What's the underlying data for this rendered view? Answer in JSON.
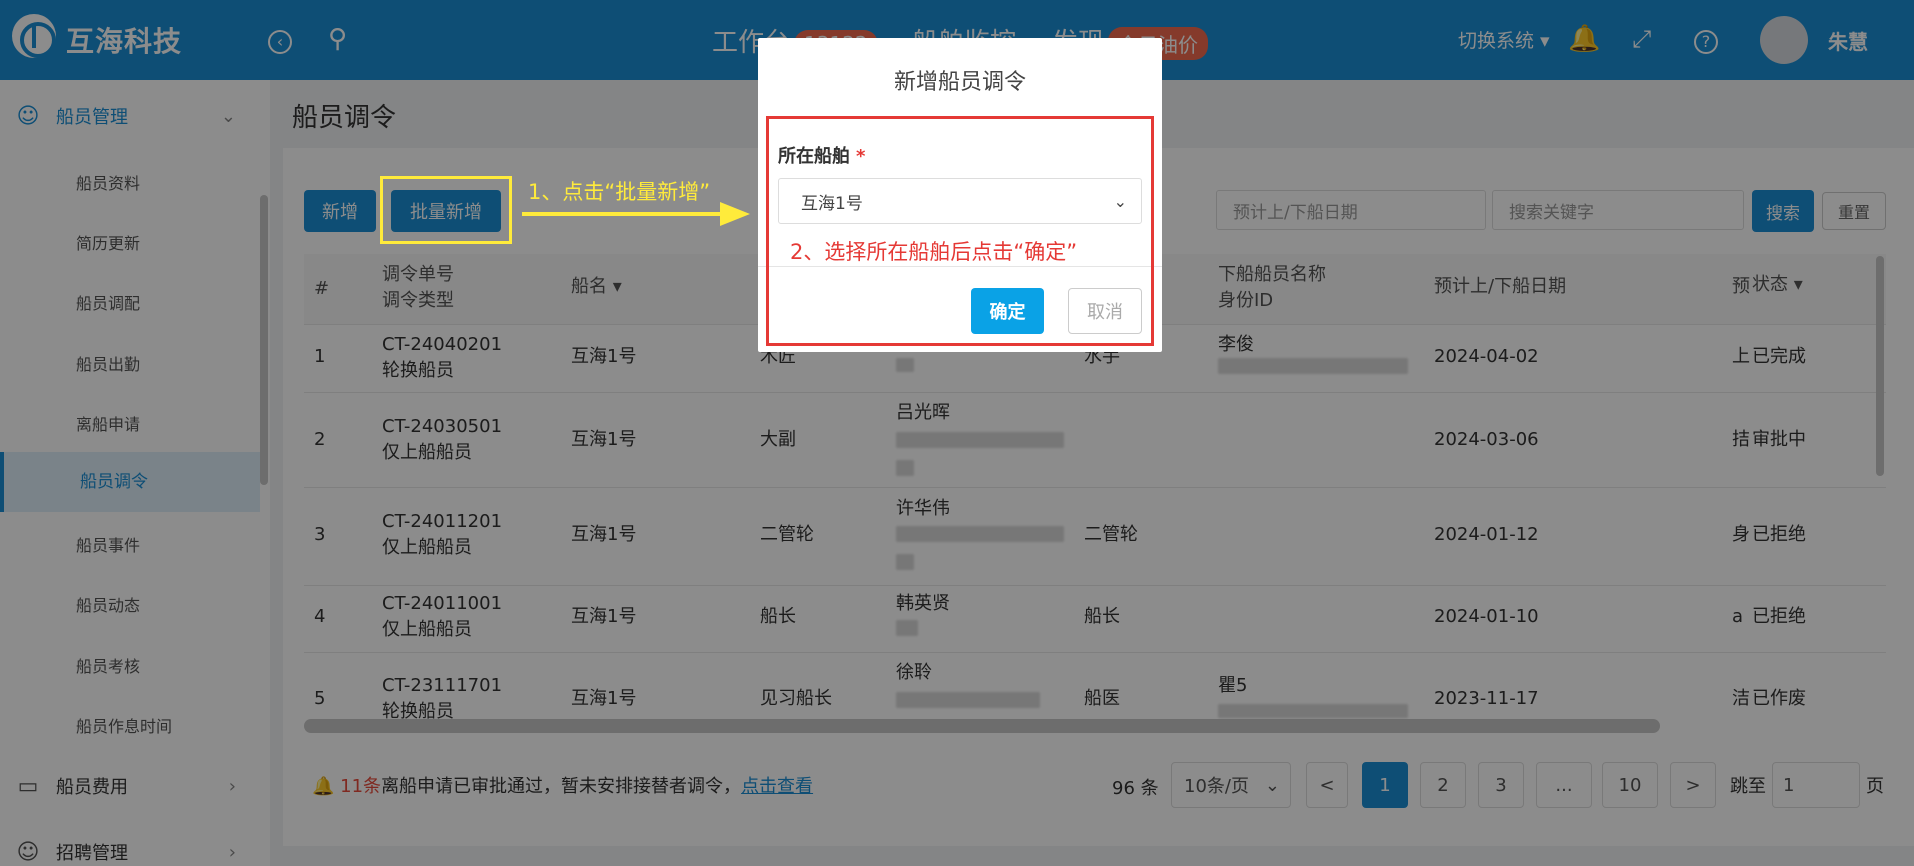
{
  "header": {
    "brand": "互海科技",
    "nav": [
      {
        "label": "工作台",
        "badge": "13122"
      },
      {
        "label": "船舶监控"
      },
      {
        "label": "发现",
        "badge": "今日油价"
      }
    ],
    "system_switch": "切换系统",
    "username": "朱慧"
  },
  "sidebar": {
    "group_main": "船员管理",
    "items": [
      "船员资料",
      "简历更新",
      "船员调配",
      "船员出勤",
      "离船申请",
      "船员调令",
      "船员事件",
      "船员动态",
      "船员考核",
      "船员作息时间"
    ],
    "group_fee": "船员费用",
    "group_recruit": "招聘管理"
  },
  "page": {
    "title": "船员调令"
  },
  "toolbar": {
    "add": "新增",
    "batch_add": "批量新增",
    "date_placeholder": "预计上/下船日期",
    "keyword_placeholder": "搜索关键字",
    "search": "搜索",
    "reset": "重置"
  },
  "table": {
    "headers": {
      "index": "#",
      "order_no": "调令单号",
      "order_type": "调令类型",
      "ship": "船名",
      "down_crew": "下船船员名称",
      "id_no": "身份ID",
      "date": "预计上/下船日期",
      "status": "状态"
    },
    "rows": [
      {
        "idx": "1",
        "no": "CT-24040201",
        "type": "轮换船员",
        "ship": "互海1号",
        "up_rank": "木匠",
        "up_name": "",
        "down_rank": "水手",
        "down_name": "李俊",
        "date": "2024-04-02",
        "extra": "上",
        "status": "已完成"
      },
      {
        "idx": "2",
        "no": "CT-24030501",
        "type": "仅上船船员",
        "ship": "互海1号",
        "up_rank": "大副",
        "up_name": "吕光晖",
        "down_rank": "",
        "down_name": "",
        "date": "2024-03-06",
        "extra": "拮",
        "status": "审批中"
      },
      {
        "idx": "3",
        "no": "CT-24011201",
        "type": "仅上船船员",
        "ship": "互海1号",
        "up_rank": "二管轮",
        "up_name": "许华伟",
        "down_rank": "二管轮",
        "down_name": "",
        "date": "2024-01-12",
        "extra": "身",
        "status": "已拒绝"
      },
      {
        "idx": "4",
        "no": "CT-24011001",
        "type": "仅上船船员",
        "ship": "互海1号",
        "up_rank": "船长",
        "up_name": "韩英贤",
        "down_rank": "船长",
        "down_name": "",
        "date": "2024-01-10",
        "extra": "a",
        "status": "已拒绝"
      },
      {
        "idx": "5",
        "no": "CT-23111701",
        "type": "轮换船员",
        "ship": "互海1号",
        "up_rank": "见习船长",
        "up_name": "徐聆",
        "down_rank": "船医",
        "down_name": "瞿5",
        "date": "2023-11-17",
        "extra": "洁",
        "status": "已作废"
      }
    ]
  },
  "footer": {
    "note_count": "11条",
    "note_text": "离船申请已审批通过，暂未安排接替者调令，",
    "note_link": "点击查看",
    "total": "96 条",
    "page_size": "10条/页",
    "prev": "<",
    "pages": [
      "1",
      "2",
      "3",
      "...",
      "10"
    ],
    "next": ">",
    "jump_label": "跳至",
    "jump_value": "1",
    "page_unit": "页"
  },
  "modal": {
    "title": "新增船员调令",
    "field_label": "所在船舶",
    "required_mark": "*",
    "selected_ship": "互海1号",
    "confirm": "确定",
    "cancel": "取消"
  },
  "annotations": {
    "step1": "1、点击“批量新增”",
    "step2": "2、选择所在船舶后点击“确定”"
  }
}
